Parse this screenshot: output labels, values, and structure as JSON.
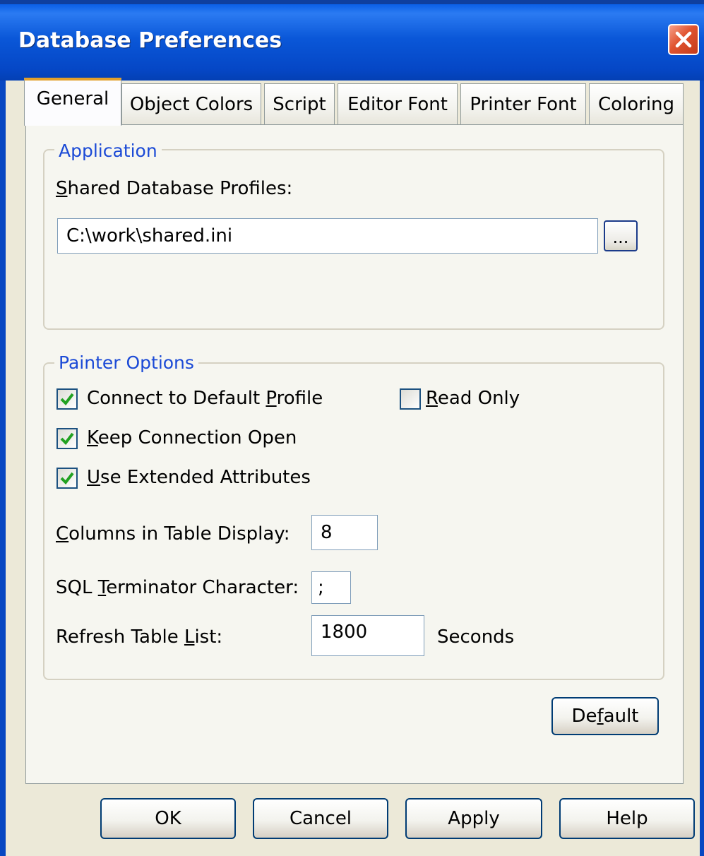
{
  "window": {
    "title": "Database Preferences"
  },
  "tabs": [
    {
      "label": "General"
    },
    {
      "label": "Object Colors"
    },
    {
      "label": "Script"
    },
    {
      "label": "Editor Font"
    },
    {
      "label": "Printer Font"
    },
    {
      "label": "Coloring"
    }
  ],
  "application": {
    "legend": "Application",
    "shared_profiles_label_ul": "S",
    "shared_profiles_label_rest": "hared Database Profiles:",
    "shared_profiles_value": "C:\\work\\shared.ini",
    "browse_label": "..."
  },
  "painter": {
    "legend": "Painter Options",
    "connect_default": {
      "pre": "Connect to Default ",
      "ul": "P",
      "post": "rofile",
      "checked": true
    },
    "read_only": {
      "pre": "",
      "ul": "R",
      "post": "ead Only",
      "checked": false
    },
    "keep_open": {
      "pre": "",
      "ul": "K",
      "post": "eep Connection Open",
      "checked": true
    },
    "extended_attrs": {
      "pre": "",
      "ul": "U",
      "post": "se Extended Attributes",
      "checked": true
    },
    "columns_label": {
      "pre": "",
      "ul": "C",
      "post": "olumns in Table Display:"
    },
    "columns_value": "8",
    "sql_label": {
      "pre": "SQL ",
      "ul": "T",
      "post": "erminator Character:"
    },
    "sql_value": ";",
    "refresh_label": {
      "pre": "Refresh Table ",
      "ul": "L",
      "post": "ist:"
    },
    "refresh_value": "1800",
    "refresh_unit": "Seconds"
  },
  "default_button": {
    "pre": "De",
    "ul": "f",
    "post": "ault"
  },
  "buttons": {
    "ok": "OK",
    "cancel": "Cancel",
    "apply": "Apply",
    "help": "Help"
  },
  "colors": {
    "titlebar": "#0a57d8",
    "legend_text": "#1b4ad6",
    "check_mark": "#21a121",
    "close_button": "#e0532f"
  }
}
